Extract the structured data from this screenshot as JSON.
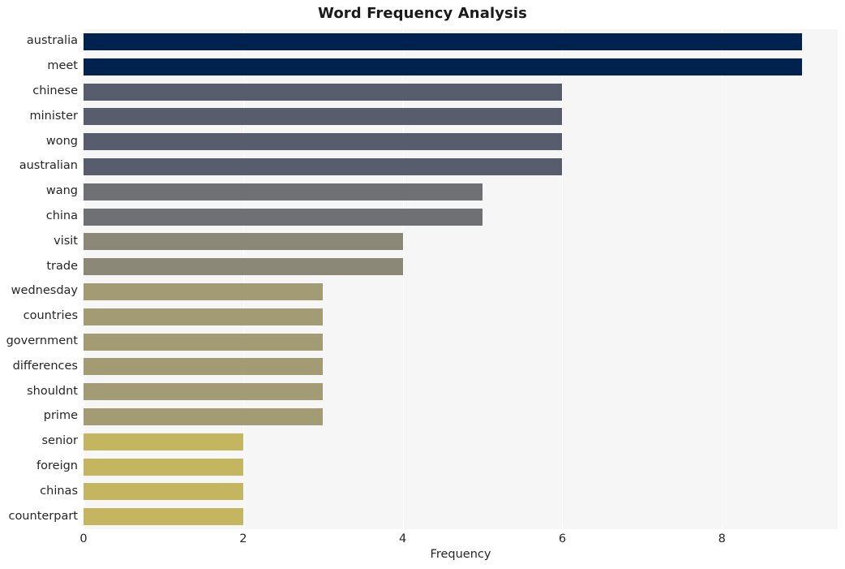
{
  "chart_data": {
    "type": "bar",
    "orientation": "horizontal",
    "title": "Word Frequency Analysis",
    "xlabel": "Frequency",
    "ylabel": "",
    "xlim": [
      0,
      9.45
    ],
    "ylim": [
      0,
      20
    ],
    "grid": true,
    "legend": null,
    "xticks": [
      "0",
      "2",
      "4",
      "6",
      "8"
    ],
    "xtick_values": [
      0,
      2,
      4,
      6,
      8
    ],
    "categories": [
      "australia",
      "meet",
      "chinese",
      "minister",
      "wong",
      "australian",
      "wang",
      "china",
      "visit",
      "trade",
      "wednesday",
      "countries",
      "government",
      "differences",
      "shouldnt",
      "prime",
      "senior",
      "foreign",
      "chinas",
      "counterpart"
    ],
    "values": [
      9,
      9,
      6,
      6,
      6,
      6,
      5,
      5,
      4,
      4,
      3,
      3,
      3,
      3,
      3,
      3,
      2,
      2,
      2,
      2
    ],
    "bar_colors": [
      "#00224e",
      "#00224e",
      "#575d6d",
      "#575d6d",
      "#575d6d",
      "#575d6d",
      "#6e7073",
      "#6e7073",
      "#8b8878",
      "#8b8878",
      "#a39b74",
      "#a39b74",
      "#a39b74",
      "#a39b74",
      "#a39b74",
      "#a39b74",
      "#c4b560",
      "#c4b560",
      "#c4b560",
      "#c4b560"
    ],
    "plot_background": "#f6f6f7",
    "gridline_color": "#ffffff",
    "figure_background": "#ffffff",
    "text_color": "#262626"
  }
}
